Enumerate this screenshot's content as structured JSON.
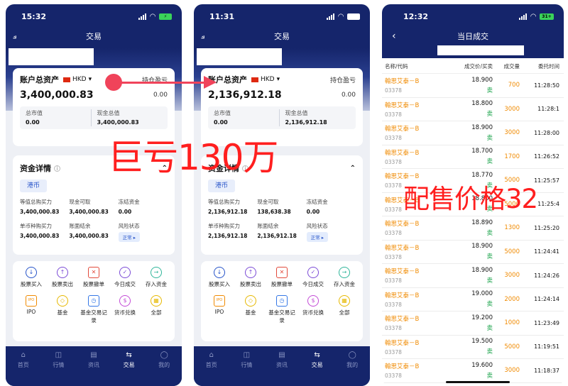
{
  "phone1": {
    "status_time": "15:32",
    "battery": "",
    "title": "交易",
    "account_label": "账户总资产",
    "currency": "HKD",
    "pnl_label": "持仓盈亏",
    "total_assets": "3,400,000.83",
    "pnl_value": "0.00",
    "market_value_label": "总市值",
    "market_value": "0.00",
    "cash_total_label": "现金总值",
    "cash_total": "3,400,000.83",
    "fund_title": "资金详情",
    "fund_tab": "港币",
    "fund_items": [
      {
        "label": "等值总购买力",
        "value": "3,400,000.83"
      },
      {
        "label": "现金可取",
        "value": "3,400,000.83"
      },
      {
        "label": "冻结资金",
        "value": "0.00"
      },
      {
        "label": "单币种购买力",
        "value": "3,400,000.83"
      },
      {
        "label": "账面结余",
        "value": "3,400,000.83"
      },
      {
        "label": "风险状态",
        "value": "正常 ▸"
      }
    ]
  },
  "phone2": {
    "status_time": "11:31",
    "title": "交易",
    "account_label": "账户总资产",
    "currency": "HKD",
    "pnl_label": "持仓盈亏",
    "total_assets": "2,136,912.18",
    "pnl_value": "0.00",
    "market_value_label": "总市值",
    "market_value": "0.00",
    "cash_total_label": "现金总值",
    "cash_total": "2,136,912.18",
    "fund_title": "资金详情",
    "fund_tab": "港币",
    "fund_items": [
      {
        "label": "等值总购买力",
        "value": "2,136,912.18"
      },
      {
        "label": "现金可取",
        "value": "138,638.38"
      },
      {
        "label": "冻结资金",
        "value": "0.00"
      },
      {
        "label": "单币种购买力",
        "value": "2,136,912.18"
      },
      {
        "label": "账面结余",
        "value": "2,136,912.18"
      },
      {
        "label": "风险状态",
        "value": "正常 ▸"
      }
    ]
  },
  "functions": [
    {
      "label": "股票买入",
      "icon": "buy-icon",
      "glyph": "↓",
      "color": ""
    },
    {
      "label": "股票卖出",
      "icon": "sell-icon",
      "glyph": "↑",
      "color": "purple"
    },
    {
      "label": "股票撤单",
      "icon": "cancel-order-icon",
      "glyph": "✕",
      "color": "red"
    },
    {
      "label": "今日成交",
      "icon": "today-deals-icon",
      "glyph": "✓",
      "color": "purple"
    },
    {
      "label": "存入资金",
      "icon": "deposit-icon",
      "glyph": "→",
      "color": "teal"
    },
    {
      "label": "IPO",
      "icon": "ipo-icon",
      "glyph": "IPO",
      "color": "orange"
    },
    {
      "label": "基金",
      "icon": "fund-icon",
      "glyph": "◇",
      "color": "yellow"
    },
    {
      "label": "基金交易记录",
      "icon": "fund-record-icon",
      "glyph": "◷",
      "color": "blue2"
    },
    {
      "label": "货币兑换",
      "icon": "exchange-icon",
      "glyph": "$",
      "color": "pink"
    },
    {
      "label": "全部",
      "icon": "all-icon",
      "glyph": "▦",
      "color": "yellow"
    }
  ],
  "tabs": [
    {
      "label": "首页",
      "icon": "home-icon",
      "glyph": "⌂"
    },
    {
      "label": "行情",
      "icon": "market-icon",
      "glyph": "◫"
    },
    {
      "label": "资讯",
      "icon": "news-icon",
      "glyph": "▤"
    },
    {
      "label": "交易",
      "icon": "trade-icon",
      "glyph": "⇆"
    },
    {
      "label": "我的",
      "icon": "profile-icon",
      "glyph": "◯"
    }
  ],
  "phone3": {
    "status_time": "12:32",
    "battery": "31+",
    "title": "当日成交",
    "headers": [
      "名称/代码",
      "成交价/买卖",
      "成交量",
      "委托时间"
    ],
    "rows": [
      {
        "name": "翰思艾泰－B",
        "code": "03378",
        "price": "18.900",
        "side": "卖",
        "qty": "700",
        "time": "11:28:50"
      },
      {
        "name": "翰思艾泰－B",
        "code": "03378",
        "price": "18.800",
        "side": "卖",
        "qty": "3000",
        "time": "11:28:1"
      },
      {
        "name": "翰思艾泰－B",
        "code": "03378",
        "price": "18.900",
        "side": "卖",
        "qty": "3000",
        "time": "11:28:00"
      },
      {
        "name": "翰思艾泰－B",
        "code": "03378",
        "price": "18.700",
        "side": "卖",
        "qty": "1700",
        "time": "11:26:52"
      },
      {
        "name": "翰思艾泰－B",
        "code": "03378",
        "price": "18.770",
        "side": "卖",
        "qty": "5000",
        "time": "11:25:57"
      },
      {
        "name": "翰思艾泰－B",
        "code": "03378",
        "price": "18.800",
        "side": "卖",
        "qty": "5000",
        "time": "11:25:4"
      },
      {
        "name": "翰思艾泰－B",
        "code": "03378",
        "price": "18.890",
        "side": "卖",
        "qty": "1300",
        "time": "11:25:20"
      },
      {
        "name": "翰思艾泰－B",
        "code": "03378",
        "price": "18.900",
        "side": "卖",
        "qty": "5000",
        "time": "11:24:41"
      },
      {
        "name": "翰思艾泰－B",
        "code": "03378",
        "price": "18.900",
        "side": "卖",
        "qty": "3000",
        "time": "11:24:26"
      },
      {
        "name": "翰思艾泰－B",
        "code": "03378",
        "price": "19.000",
        "side": "卖",
        "qty": "2000",
        "time": "11:24:14"
      },
      {
        "name": "翰思艾泰－B",
        "code": "03378",
        "price": "19.200",
        "side": "卖",
        "qty": "1000",
        "time": "11:23:49"
      },
      {
        "name": "翰思艾泰－B",
        "code": "03378",
        "price": "19.500",
        "side": "卖",
        "qty": "5000",
        "time": "11:19:51"
      },
      {
        "name": "翰思艾泰－B",
        "code": "03378",
        "price": "19.600",
        "side": "卖",
        "qty": "3000",
        "time": "11:18:37"
      }
    ]
  },
  "overlays": {
    "loss_text": "巨亏130万",
    "price_text": "配售价格32"
  },
  "colors": {
    "navy": "#15256b",
    "accent_red": "#ff1f1f",
    "orange": "#f08a00",
    "green": "#1aa34a",
    "blue": "#2653c9"
  }
}
